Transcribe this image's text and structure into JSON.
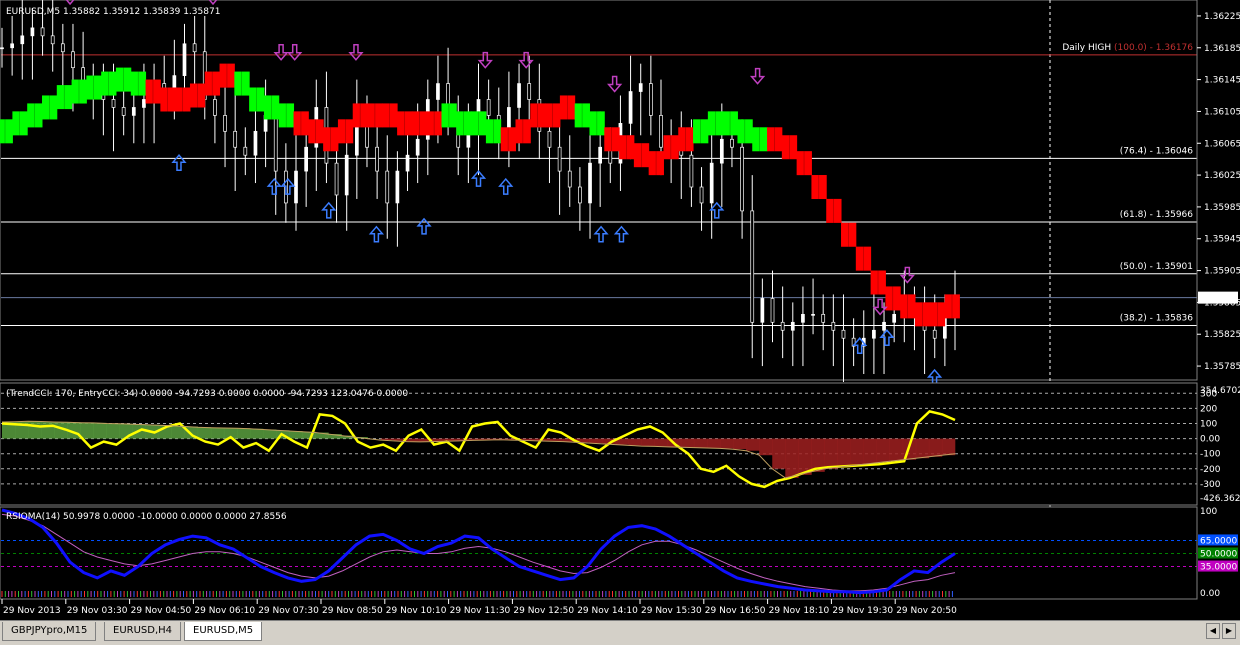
{
  "window": {
    "tabs": [
      {
        "label": "GBPJPYpro,M15",
        "active": false
      },
      {
        "label": "EURUSD,H4",
        "active": false
      },
      {
        "label": "EURUSD,M5",
        "active": true
      }
    ]
  },
  "colors": {
    "background": "#000000",
    "bull_candle": "#ffffff",
    "up_arrow": "#3b7dff",
    "down_arrow": "#c040c0",
    "trend_up": "#00ff00",
    "trend_down": "#ff0000",
    "cci_line": "#ffff00",
    "rsioma_line": "#1010ff",
    "rsioma_signal": "#c060c0",
    "daily_high": "#c03030",
    "level_65": "#0050ff",
    "level_50": "#008000",
    "level_35": "#c000c0"
  },
  "chart_data": [
    {
      "type": "line",
      "panel": "price",
      "header": "EURUSD,M5  1.35882 1.35912 1.35839 1.35871",
      "symbol": "EURUSD,M5",
      "ohlc": {
        "open": 1.35882,
        "high": 1.35912,
        "low": 1.35839,
        "close": 1.35871
      },
      "current_price": "1.35871",
      "ylim": [
        1.3577,
        1.3624
      ],
      "y_ticks": [
        "1.36225",
        "1.36185",
        "1.36145",
        "1.36105",
        "1.36065",
        "1.36025",
        "1.35985",
        "1.35945",
        "1.35905",
        "1.35865",
        "1.35825",
        "1.35785"
      ],
      "x_ticks": [
        "29 Nov 2013",
        "29 Nov 03:30",
        "29 Nov 04:50",
        "29 Nov 06:10",
        "29 Nov 07:30",
        "29 Nov 08:50",
        "29 Nov 10:10",
        "29 Nov 11:30",
        "29 Nov 12:50",
        "29 Nov 14:10",
        "29 Nov 15:30",
        "29 Nov 16:50",
        "29 Nov 18:10",
        "29 Nov 19:30",
        "29 Nov 20:50"
      ],
      "fib_levels": [
        {
          "label": "Daily HIGH",
          "pct": "(100.0)",
          "value": "1.36176",
          "y": 1.36176
        },
        {
          "label": "",
          "pct": "(76.4)",
          "value": "1.36046",
          "y": 1.36046
        },
        {
          "label": "",
          "pct": "(61.8)",
          "value": "1.35966",
          "y": 1.35966
        },
        {
          "label": "",
          "pct": "(50.0)",
          "value": "1.35901",
          "y": 1.35901
        },
        {
          "label": "",
          "pct": "(38.2)",
          "value": "1.35836",
          "y": 1.35836
        }
      ],
      "close_series": [
        1.36185,
        1.3619,
        1.362,
        1.3621,
        1.362,
        1.3619,
        1.3618,
        1.3616,
        1.3614,
        1.3613,
        1.3612,
        1.3611,
        1.361,
        1.3611,
        1.3612,
        1.3614,
        1.3613,
        1.3615,
        1.3619,
        1.3618,
        1.3612,
        1.361,
        1.3608,
        1.3606,
        1.3605,
        1.3608,
        1.361,
        1.3603,
        1.3599,
        1.3603,
        1.3606,
        1.3611,
        1.3604,
        1.36,
        1.3605,
        1.361,
        1.3606,
        1.3603,
        1.3599,
        1.3603,
        1.3605,
        1.3607,
        1.3612,
        1.3614,
        1.361,
        1.3606,
        1.3608,
        1.3612,
        1.361,
        1.3608,
        1.3611,
        1.3614,
        1.3612,
        1.3608,
        1.3606,
        1.3603,
        1.3601,
        1.3599,
        1.3604,
        1.3606,
        1.3604,
        1.3609,
        1.3613,
        1.3614,
        1.361,
        1.3606,
        1.3607,
        1.3605,
        1.3601,
        1.3599,
        1.3604,
        1.3607,
        1.3606,
        1.3598,
        1.3584,
        1.3587,
        1.3584,
        1.3583,
        1.3584,
        1.3585,
        1.3585,
        1.3584,
        1.3583,
        1.3582,
        1.3581,
        1.3582,
        1.3583,
        1.3584,
        1.3585,
        1.3586,
        1.3585,
        1.3583,
        1.3582,
        1.3585,
        1.3587
      ],
      "trend_series": [
        1.3608,
        1.3609,
        1.361,
        1.3611,
        1.36123,
        1.3613,
        1.36135,
        1.3614,
        1.36145,
        1.3614,
        1.3613,
        1.3612,
        1.3612,
        1.36125,
        1.3614,
        1.3615,
        1.3614,
        1.3612,
        1.3611,
        1.361,
        1.3609,
        1.3608,
        1.3607,
        1.3608,
        1.361,
        1.361,
        1.361,
        1.3609,
        1.3609,
        1.3609,
        1.361,
        1.3609,
        1.3609,
        1.3608,
        1.3607,
        1.3608,
        1.361,
        1.361,
        1.3611,
        1.361,
        1.3609,
        1.3607,
        1.3606,
        1.3605,
        1.3604,
        1.3606,
        1.3607,
        1.3608,
        1.3609,
        1.3609,
        1.3608,
        1.3607,
        1.3607,
        1.3606,
        1.3604,
        1.3601,
        1.3598,
        1.3595,
        1.3592,
        1.3589,
        1.3587,
        1.3586,
        1.3585,
        1.3585,
        1.3586
      ],
      "trend_colors": "GGGGGGGGGGRRRRRRGGGGRRRRRRRRRRGGGGRRRRRGGRRRRRRGGGGGRRRRRRRRRRRRRRRRRRRRRRRRRRRRRRRRRRRG",
      "up_arrows": [
        {
          "x_index": 26,
          "y": 1.3605
        },
        {
          "x_index": 40,
          "y": 1.3602
        },
        {
          "x_index": 42,
          "y": 1.3602
        },
        {
          "x_index": 48,
          "y": 1.3599
        },
        {
          "x_index": 55,
          "y": 1.3596
        },
        {
          "x_index": 62,
          "y": 1.3597
        },
        {
          "x_index": 70,
          "y": 1.3603
        },
        {
          "x_index": 74,
          "y": 1.3602
        },
        {
          "x_index": 88,
          "y": 1.3596
        },
        {
          "x_index": 91,
          "y": 1.3596
        },
        {
          "x_index": 105,
          "y": 1.3599
        },
        {
          "x_index": 126,
          "y": 1.3582
        },
        {
          "x_index": 130,
          "y": 1.3583
        },
        {
          "x_index": 137,
          "y": 1.3578
        }
      ],
      "down_arrows": [
        {
          "x_index": 10,
          "y": 1.3624
        },
        {
          "x_index": 31,
          "y": 1.3624
        },
        {
          "x_index": 41,
          "y": 1.3617
        },
        {
          "x_index": 43,
          "y": 1.3617
        },
        {
          "x_index": 52,
          "y": 1.3617
        },
        {
          "x_index": 71,
          "y": 1.3616
        },
        {
          "x_index": 77,
          "y": 1.3616
        },
        {
          "x_index": 90,
          "y": 1.3613
        },
        {
          "x_index": 99,
          "y": 1.3625
        },
        {
          "x_index": 111,
          "y": 1.3614
        },
        {
          "x_index": 129,
          "y": 1.3585
        },
        {
          "x_index": 133,
          "y": 1.3589
        }
      ]
    },
    {
      "type": "area",
      "panel": "cci",
      "header": "(TrendCCI: 170, EntryCCI: 34)  0.0000 -94.7293 0.0000 0.0000 -94.7293 123.0476 0.0000",
      "max_label": "354.6702",
      "min_label": "-426.3622",
      "ylim": [
        -426.3622,
        354.6702
      ],
      "levels": [
        300,
        200,
        100,
        0,
        -100,
        -200,
        -300
      ],
      "y_ticks": [
        "300",
        "200",
        "100",
        "0.00",
        "-100",
        "-200",
        "-300"
      ],
      "trend_cci": [
        110,
        112,
        115,
        113,
        110,
        108,
        105,
        104,
        100,
        98,
        95,
        92,
        88,
        85,
        80,
        75,
        72,
        70,
        68,
        65,
        60,
        55,
        50,
        45,
        40,
        30,
        20,
        10,
        0,
        -10,
        -15,
        -20,
        -22,
        -20,
        -18,
        -15,
        -12,
        -10,
        -8,
        -10,
        -12,
        -15,
        -18,
        -20,
        -25,
        -30,
        -35,
        -40,
        -45,
        -50,
        -52,
        -55,
        -58,
        -60,
        -62,
        -65,
        -70,
        -80,
        -110,
        -200,
        -260,
        -240,
        -220,
        -200,
        -190,
        -180,
        -170,
        -160,
        -150,
        -140,
        -130,
        -120,
        -110,
        -100
      ],
      "entry_cci": [
        100,
        95,
        90,
        80,
        85,
        60,
        30,
        -60,
        -20,
        -40,
        20,
        60,
        40,
        80,
        100,
        20,
        -20,
        -40,
        10,
        -60,
        -30,
        -80,
        30,
        -20,
        -60,
        160,
        150,
        100,
        -20,
        -60,
        -40,
        -80,
        20,
        60,
        -40,
        -20,
        -80,
        80,
        100,
        110,
        20,
        -20,
        -60,
        60,
        40,
        -10,
        -50,
        -80,
        -20,
        20,
        60,
        80,
        40,
        -40,
        -100,
        -200,
        -220,
        -180,
        -250,
        -300,
        -320,
        -280,
        -260,
        -230,
        -200,
        -190,
        -185,
        -180,
        -175,
        -170,
        -160,
        -150,
        100,
        180,
        160,
        123
      ]
    },
    {
      "type": "line",
      "panel": "rsioma",
      "header": "RSIOMA(14) 50.9978 0.0000 -10.0000 0.0000 0.0000 27.8556",
      "ylim": [
        0,
        100
      ],
      "y_ticks": [
        "100",
        "0.00"
      ],
      "levels": [
        {
          "value": 65,
          "label": "65.0000"
        },
        {
          "value": 50,
          "label": "50.0000"
        },
        {
          "value": 35,
          "label": "35.0000"
        }
      ],
      "rsioma": [
        100,
        96,
        90,
        80,
        62,
        40,
        28,
        22,
        30,
        25,
        35,
        50,
        60,
        66,
        70,
        68,
        60,
        55,
        45,
        35,
        28,
        22,
        18,
        20,
        30,
        45,
        60,
        70,
        72,
        65,
        55,
        50,
        58,
        62,
        70,
        68,
        55,
        45,
        35,
        30,
        25,
        20,
        22,
        35,
        55,
        70,
        80,
        82,
        78,
        70,
        60,
        50,
        40,
        30,
        22,
        18,
        15,
        12,
        10,
        8,
        7,
        6,
        6,
        5,
        6,
        8,
        20,
        30,
        28,
        40,
        50
      ],
      "signal": [
        95,
        93,
        88,
        82,
        72,
        62,
        52,
        46,
        42,
        38,
        36,
        38,
        42,
        46,
        50,
        52,
        52,
        50,
        46,
        40,
        34,
        28,
        24,
        22,
        24,
        30,
        38,
        46,
        52,
        54,
        52,
        50,
        50,
        52,
        56,
        58,
        56,
        52,
        46,
        40,
        35,
        30,
        27,
        28,
        34,
        42,
        52,
        60,
        64,
        64,
        60,
        54,
        47,
        40,
        33,
        27,
        22,
        18,
        15,
        12,
        10,
        8,
        7,
        7,
        8,
        10,
        14,
        18,
        20,
        25,
        28
      ]
    }
  ]
}
